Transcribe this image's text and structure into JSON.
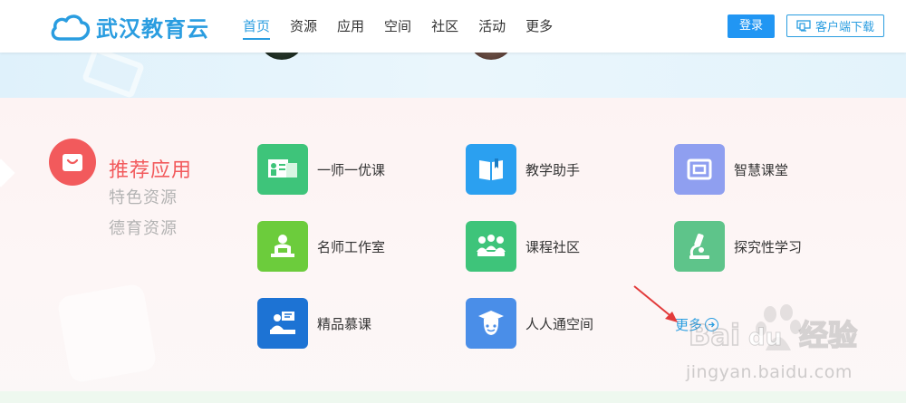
{
  "header": {
    "logo_text": "武汉教育云",
    "nav": [
      {
        "label": "首页",
        "active": true
      },
      {
        "label": "资源",
        "active": false
      },
      {
        "label": "应用",
        "active": false
      },
      {
        "label": "空间",
        "active": false
      },
      {
        "label": "社区",
        "active": false
      },
      {
        "label": "活动",
        "active": false
      },
      {
        "label": "更多",
        "active": false
      }
    ],
    "login_label": "登录",
    "download_label": "客户端下载"
  },
  "categories": {
    "active": "推荐应用",
    "items": [
      "特色资源",
      "德育资源"
    ]
  },
  "apps": [
    {
      "label": "一师一优课",
      "icon": "class-board-icon",
      "color": "#3ec47a"
    },
    {
      "label": "教学助手",
      "icon": "book-bookmark-icon",
      "color": "#2ba0f0"
    },
    {
      "label": "智慧课堂",
      "icon": "screen-frame-icon",
      "color": "#8f9ff0"
    },
    {
      "label": "名师工作室",
      "icon": "teacher-desk-icon",
      "color": "#6ccc3c"
    },
    {
      "label": "课程社区",
      "icon": "people-group-icon",
      "color": "#3ec47a"
    },
    {
      "label": "探究性学习",
      "icon": "microscope-icon",
      "color": "#5ec48a"
    },
    {
      "label": "精品慕课",
      "icon": "lecturer-icon",
      "color": "#1d73d4"
    },
    {
      "label": "人人通空间",
      "icon": "graduate-cap-icon",
      "color": "#4a8ee8"
    }
  ],
  "more_label": "更多",
  "watermark": {
    "brand": "Baidu经验",
    "url": "jingyan.baidu.com"
  },
  "colors": {
    "accent": "#2a9de0",
    "category_active": "#f25a5c",
    "annotation_arrow": "#e23b3b"
  }
}
